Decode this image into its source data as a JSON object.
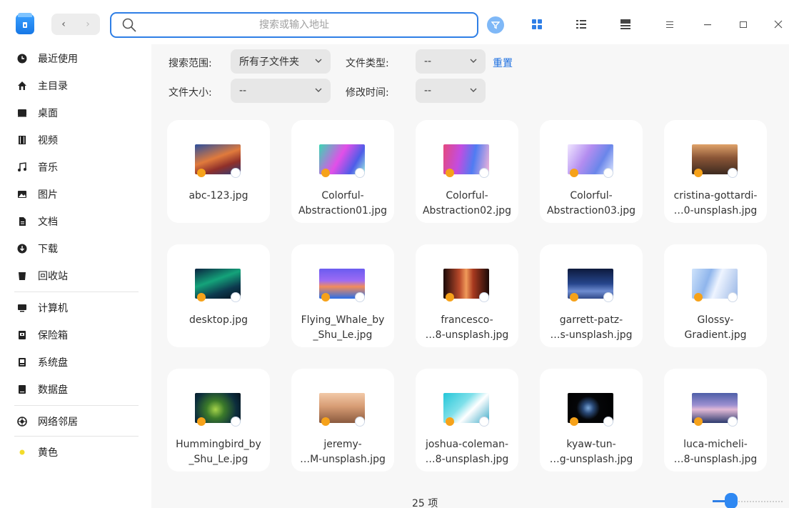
{
  "toolbar": {
    "search_placeholder": "搜索或输入地址",
    "back_label": "‹",
    "forward_label": "›"
  },
  "sidebar": {
    "items": [
      {
        "label": "最近使用",
        "icon": "clock-icon"
      },
      {
        "label": "主目录",
        "icon": "home-icon"
      },
      {
        "label": "桌面",
        "icon": "desktop-icon"
      },
      {
        "label": "视频",
        "icon": "video-icon"
      },
      {
        "label": "音乐",
        "icon": "music-icon"
      },
      {
        "label": "图片",
        "icon": "picture-icon"
      },
      {
        "label": "文档",
        "icon": "document-icon"
      },
      {
        "label": "下载",
        "icon": "download-icon"
      },
      {
        "label": "回收站",
        "icon": "trash-icon"
      },
      {
        "label": "计算机",
        "icon": "computer-icon"
      },
      {
        "label": "保险箱",
        "icon": "vault-icon"
      },
      {
        "label": "系统盘",
        "icon": "system-disk-icon"
      },
      {
        "label": "数据盘",
        "icon": "data-disk-icon"
      },
      {
        "label": "网络邻居",
        "icon": "network-icon"
      },
      {
        "label": "黄色",
        "icon": "yellow-tag-icon"
      }
    ]
  },
  "filters": {
    "scope_label": "搜索范围:",
    "scope_value": "所有子文件夹",
    "type_label": "文件类型:",
    "type_value": "--",
    "reset_label": "重置",
    "size_label": "文件大小:",
    "size_value": "--",
    "modified_label": "修改时间:",
    "modified_value": "--"
  },
  "files": [
    {
      "name": "abc-123.jpg"
    },
    {
      "name": "Colorful-\nAbstraction01.jpg"
    },
    {
      "name": "Colorful-\nAbstraction02.jpg"
    },
    {
      "name": "Colorful-\nAbstraction03.jpg"
    },
    {
      "name": "cristina-gottardi-\n…0-unsplash.jpg"
    },
    {
      "name": "desktop.jpg"
    },
    {
      "name": "Flying_Whale_by\n_Shu_Le.jpg"
    },
    {
      "name": "francesco-\n…8-unsplash.jpg"
    },
    {
      "name": "garrett-patz-\n…s-unsplash.jpg"
    },
    {
      "name": "Glossy-\nGradient.jpg"
    },
    {
      "name": "Hummingbird_by\n_Shu_Le.jpg"
    },
    {
      "name": "jeremy-\n…M-unsplash.jpg"
    },
    {
      "name": "joshua-coleman-\n…8-unsplash.jpg"
    },
    {
      "name": "kyaw-tun-\n…g-unsplash.jpg"
    },
    {
      "name": "luca-micheli-\n…8-unsplash.jpg"
    }
  ],
  "status": {
    "count": "25 项"
  },
  "colors": {
    "accent": "#2f7fe6",
    "lock_badge": "#f6a21a"
  }
}
